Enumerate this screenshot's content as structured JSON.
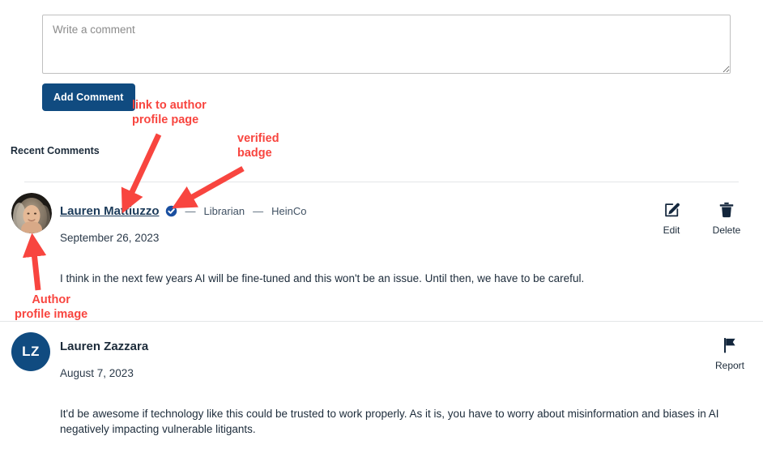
{
  "composer": {
    "placeholder": "Write a comment",
    "value": "",
    "submit_label": "Add Comment",
    "button_color": "#104b80"
  },
  "section": {
    "heading": "Recent Comments"
  },
  "comments": [
    {
      "author": "Lauren Mattiuzzo",
      "author_is_link": true,
      "verified": true,
      "role": "Librarian",
      "organization": "HeinCo",
      "separator": "—",
      "date": "September 26, 2023",
      "body": "I think in the next few years AI will be fine-tuned and this won't be an issue. Until then, we have to be careful.",
      "avatar_type": "photo",
      "actions": [
        {
          "label": "Edit",
          "icon": "edit-pencil-icon"
        },
        {
          "label": "Delete",
          "icon": "trash-icon"
        }
      ]
    },
    {
      "author": "Lauren Zazzara",
      "author_is_link": false,
      "verified": false,
      "role": "",
      "organization": "",
      "separator": "",
      "date": "August 7, 2023",
      "body": "It'd be awesome if technology like this could be trusted to work properly. As it is, you have to worry about misinformation and biases in AI negatively impacting vulnerable litigants.",
      "avatar_type": "initials",
      "avatar_initials": "LZ",
      "avatar_color": "#104b80",
      "actions": [
        {
          "label": "Report",
          "icon": "flag-icon"
        }
      ]
    }
  ],
  "annotations": {
    "color": "#f8453f",
    "items": [
      {
        "text": "link to author\nprofile page"
      },
      {
        "text": "verified\nbadge"
      },
      {
        "text": "Author\nprofile image"
      }
    ]
  }
}
